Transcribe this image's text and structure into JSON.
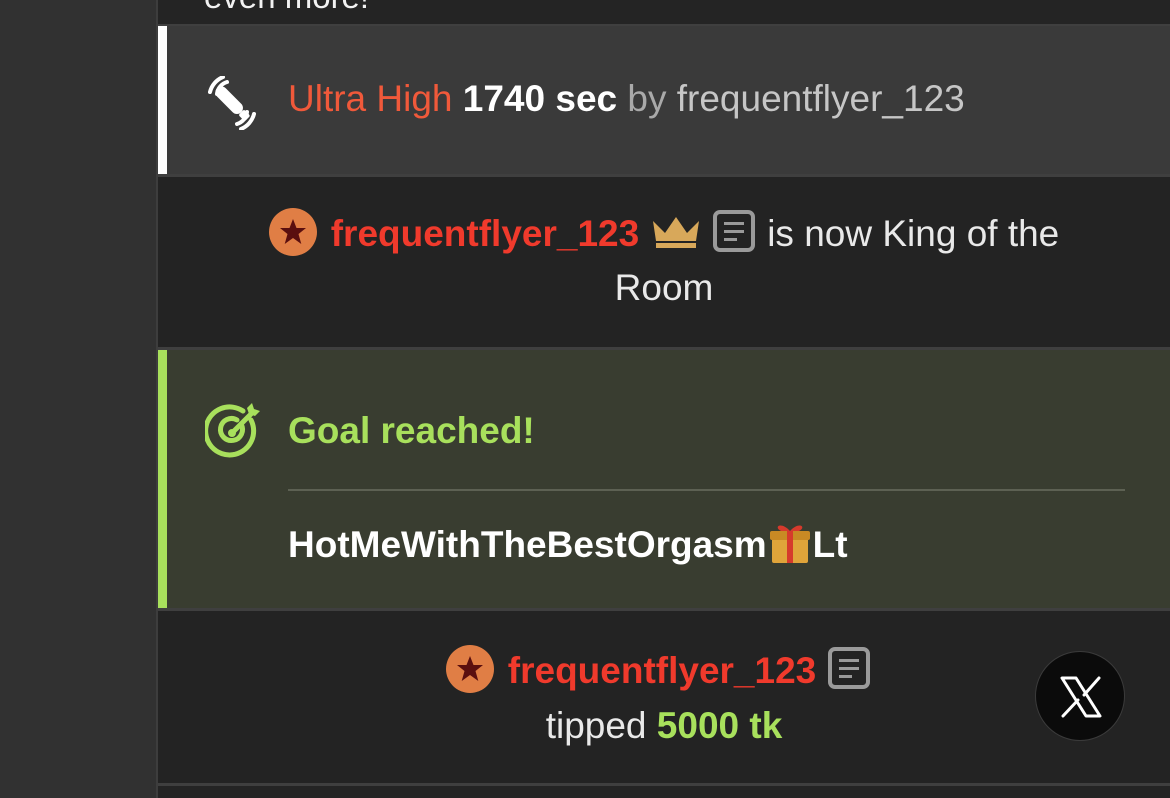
{
  "partial_message": {
    "text": "even more! "
  },
  "vibration": {
    "level": "Ultra High",
    "duration": "1740 sec",
    "by_label": "by",
    "username": "frequentflyer_123"
  },
  "king": {
    "username": "frequentflyer_123",
    "text_line1": "is now King of the",
    "text_line2": "Room"
  },
  "goal": {
    "title": "Goal reached!",
    "description_before": "HotMeWithTheBestOrgasm",
    "description_after": "Lt"
  },
  "tip": {
    "username": "frequentflyer_123",
    "tipped_label": "tipped",
    "amount": "5000 tk"
  },
  "icons": {
    "vibration": "vibrator-icon",
    "goal": "target-icon",
    "badge": "star-badge-icon",
    "crown": "crown-icon",
    "note": "note-icon",
    "close": "x-close-icon"
  },
  "colors": {
    "username": "#f03a2c",
    "level": "#f0593a",
    "goal": "#a8e05c",
    "badge": "#e07e45",
    "crown": "#d8a85a"
  }
}
